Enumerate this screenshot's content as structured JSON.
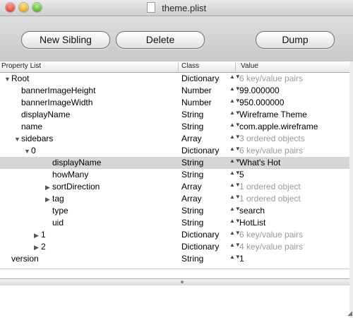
{
  "window": {
    "title": "theme.plist"
  },
  "toolbar": {
    "new_sibling": "New Sibling",
    "delete": "Delete",
    "dump": "Dump"
  },
  "columns": {
    "property": "Property List",
    "class": "Class",
    "value": "Value"
  },
  "icons": {
    "expanded": "▼",
    "collapsed": "▶",
    "stepper": "▲▼",
    "resize": "◢"
  },
  "rows": [
    {
      "key": "Root",
      "class": "Dictionary",
      "value": "6 key/value pairs",
      "gray": true
    },
    {
      "key": "bannerImageHeight",
      "class": "Number",
      "value": "99.000000",
      "gray": false
    },
    {
      "key": "bannerImageWidth",
      "class": "Number",
      "value": "950.000000",
      "gray": false
    },
    {
      "key": "displayName",
      "class": "String",
      "value": "Wireframe Theme",
      "gray": false
    },
    {
      "key": "name",
      "class": "String",
      "value": "com.apple.wireframe",
      "gray": false
    },
    {
      "key": "sidebars",
      "class": "Array",
      "value": "3 ordered objects",
      "gray": true
    },
    {
      "key": "0",
      "class": "Dictionary",
      "value": "6 key/value pairs",
      "gray": true
    },
    {
      "key": "displayName",
      "class": "String",
      "value": "What's Hot",
      "gray": false
    },
    {
      "key": "howMany",
      "class": "String",
      "value": "5",
      "gray": false
    },
    {
      "key": "sortDirection",
      "class": "Array",
      "value": "1 ordered object",
      "gray": true
    },
    {
      "key": "tag",
      "class": "Array",
      "value": "1 ordered object",
      "gray": true
    },
    {
      "key": "type",
      "class": "String",
      "value": "search",
      "gray": false
    },
    {
      "key": "uid",
      "class": "String",
      "value": "HotList",
      "gray": false
    },
    {
      "key": "1",
      "class": "Dictionary",
      "value": "6 key/value pairs",
      "gray": true
    },
    {
      "key": "2",
      "class": "Dictionary",
      "value": "4 key/value pairs",
      "gray": true
    },
    {
      "key": "version",
      "class": "String",
      "value": "1",
      "gray": false
    }
  ]
}
